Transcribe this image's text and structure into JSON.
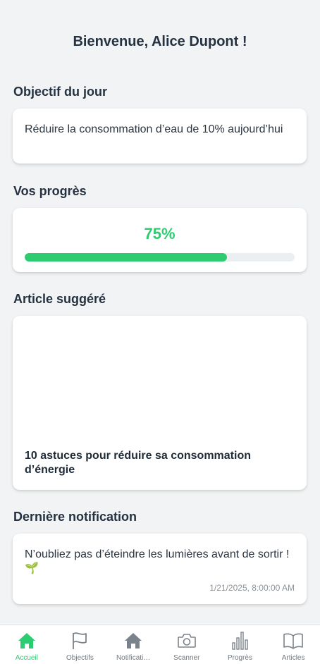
{
  "welcome": "Bienvenue, Alice Dupont !",
  "goal": {
    "heading": "Objectif du jour",
    "text": "Réduire la consommation d’eau de 10% aujourd’hui"
  },
  "progress": {
    "heading": "Vos progrès",
    "label": "75%",
    "value": 0.75
  },
  "article": {
    "heading": "Article suggéré",
    "title": "10 astuces pour réduire sa consommation d’énergie"
  },
  "notification": {
    "heading": "Dernière notification",
    "text": "N’oubliez pas d’éteindre les lumières avant de sortir ! 🌱",
    "time": "1/21/2025, 8:00:00 AM"
  },
  "tabs": [
    {
      "label": "Accueil",
      "icon": "home-icon",
      "active": true
    },
    {
      "label": "Objectifs",
      "icon": "flag-icon",
      "active": false
    },
    {
      "label": "Notificati…",
      "icon": "home-icon",
      "active": false
    },
    {
      "label": "Scanner",
      "icon": "camera-icon",
      "active": false
    },
    {
      "label": "Progrès",
      "icon": "bar-chart-icon",
      "active": false
    },
    {
      "label": "Articles",
      "icon": "book-icon",
      "active": false
    }
  ],
  "colors": {
    "accent": "#2ecc71",
    "icon_inactive": "#7a838b",
    "text": "#243241"
  }
}
